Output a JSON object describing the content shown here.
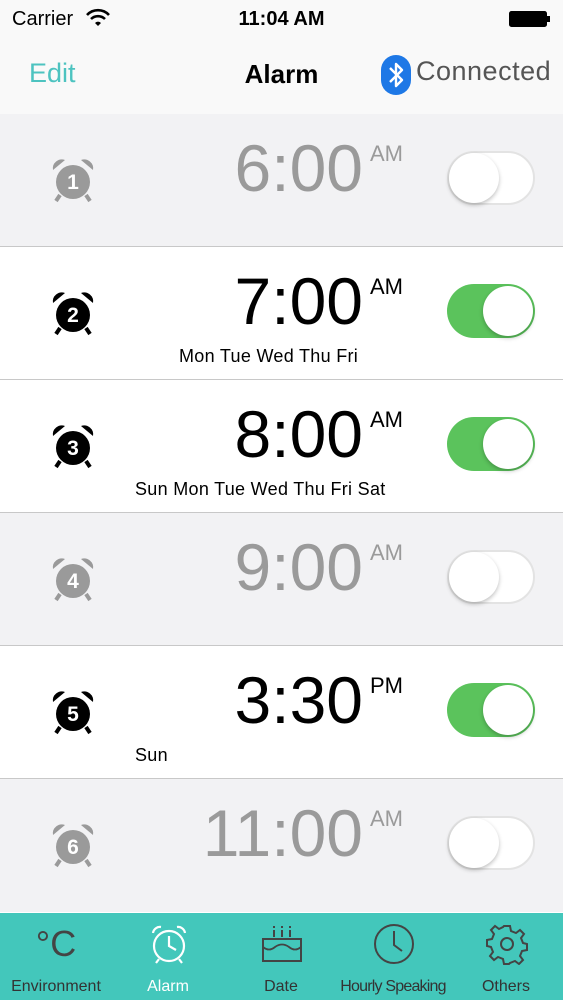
{
  "status_bar": {
    "carrier": "Carrier",
    "time": "11:04 AM"
  },
  "nav": {
    "edit_label": "Edit",
    "title": "Alarm",
    "connection_status": "Connected"
  },
  "colors": {
    "accent": "#4dc3c0",
    "toggle_on": "#5bc35c",
    "tab_bar": "#43c7bb",
    "bluetooth": "#1e78e6"
  },
  "alarms": [
    {
      "number": "1",
      "time": "6:00",
      "ampm": "AM",
      "days": "",
      "enabled": false
    },
    {
      "number": "2",
      "time": "7:00",
      "ampm": "AM",
      "days": "Mon  Tue  Wed  Thu  Fri",
      "enabled": true
    },
    {
      "number": "3",
      "time": "8:00",
      "ampm": "AM",
      "days": "Sun  Mon  Tue  Wed  Thu  Fri  Sat",
      "enabled": true
    },
    {
      "number": "4",
      "time": "9:00",
      "ampm": "AM",
      "days": "",
      "enabled": false
    },
    {
      "number": "5",
      "time": "3:30",
      "ampm": "PM",
      "days": "Sun",
      "enabled": true
    },
    {
      "number": "6",
      "time": "11:00",
      "ampm": "AM",
      "days": "",
      "enabled": false
    }
  ],
  "tabs": [
    {
      "label": "Environment",
      "icon": "celsius-icon",
      "glyph": "°C",
      "active": false
    },
    {
      "label": "Alarm",
      "icon": "alarm-clock-icon",
      "active": true
    },
    {
      "label": "Date",
      "icon": "cake-icon",
      "active": false
    },
    {
      "label": "Hourly Speaking",
      "icon": "clock-icon",
      "active": false
    },
    {
      "label": "Others",
      "icon": "gear-icon",
      "active": false
    }
  ]
}
